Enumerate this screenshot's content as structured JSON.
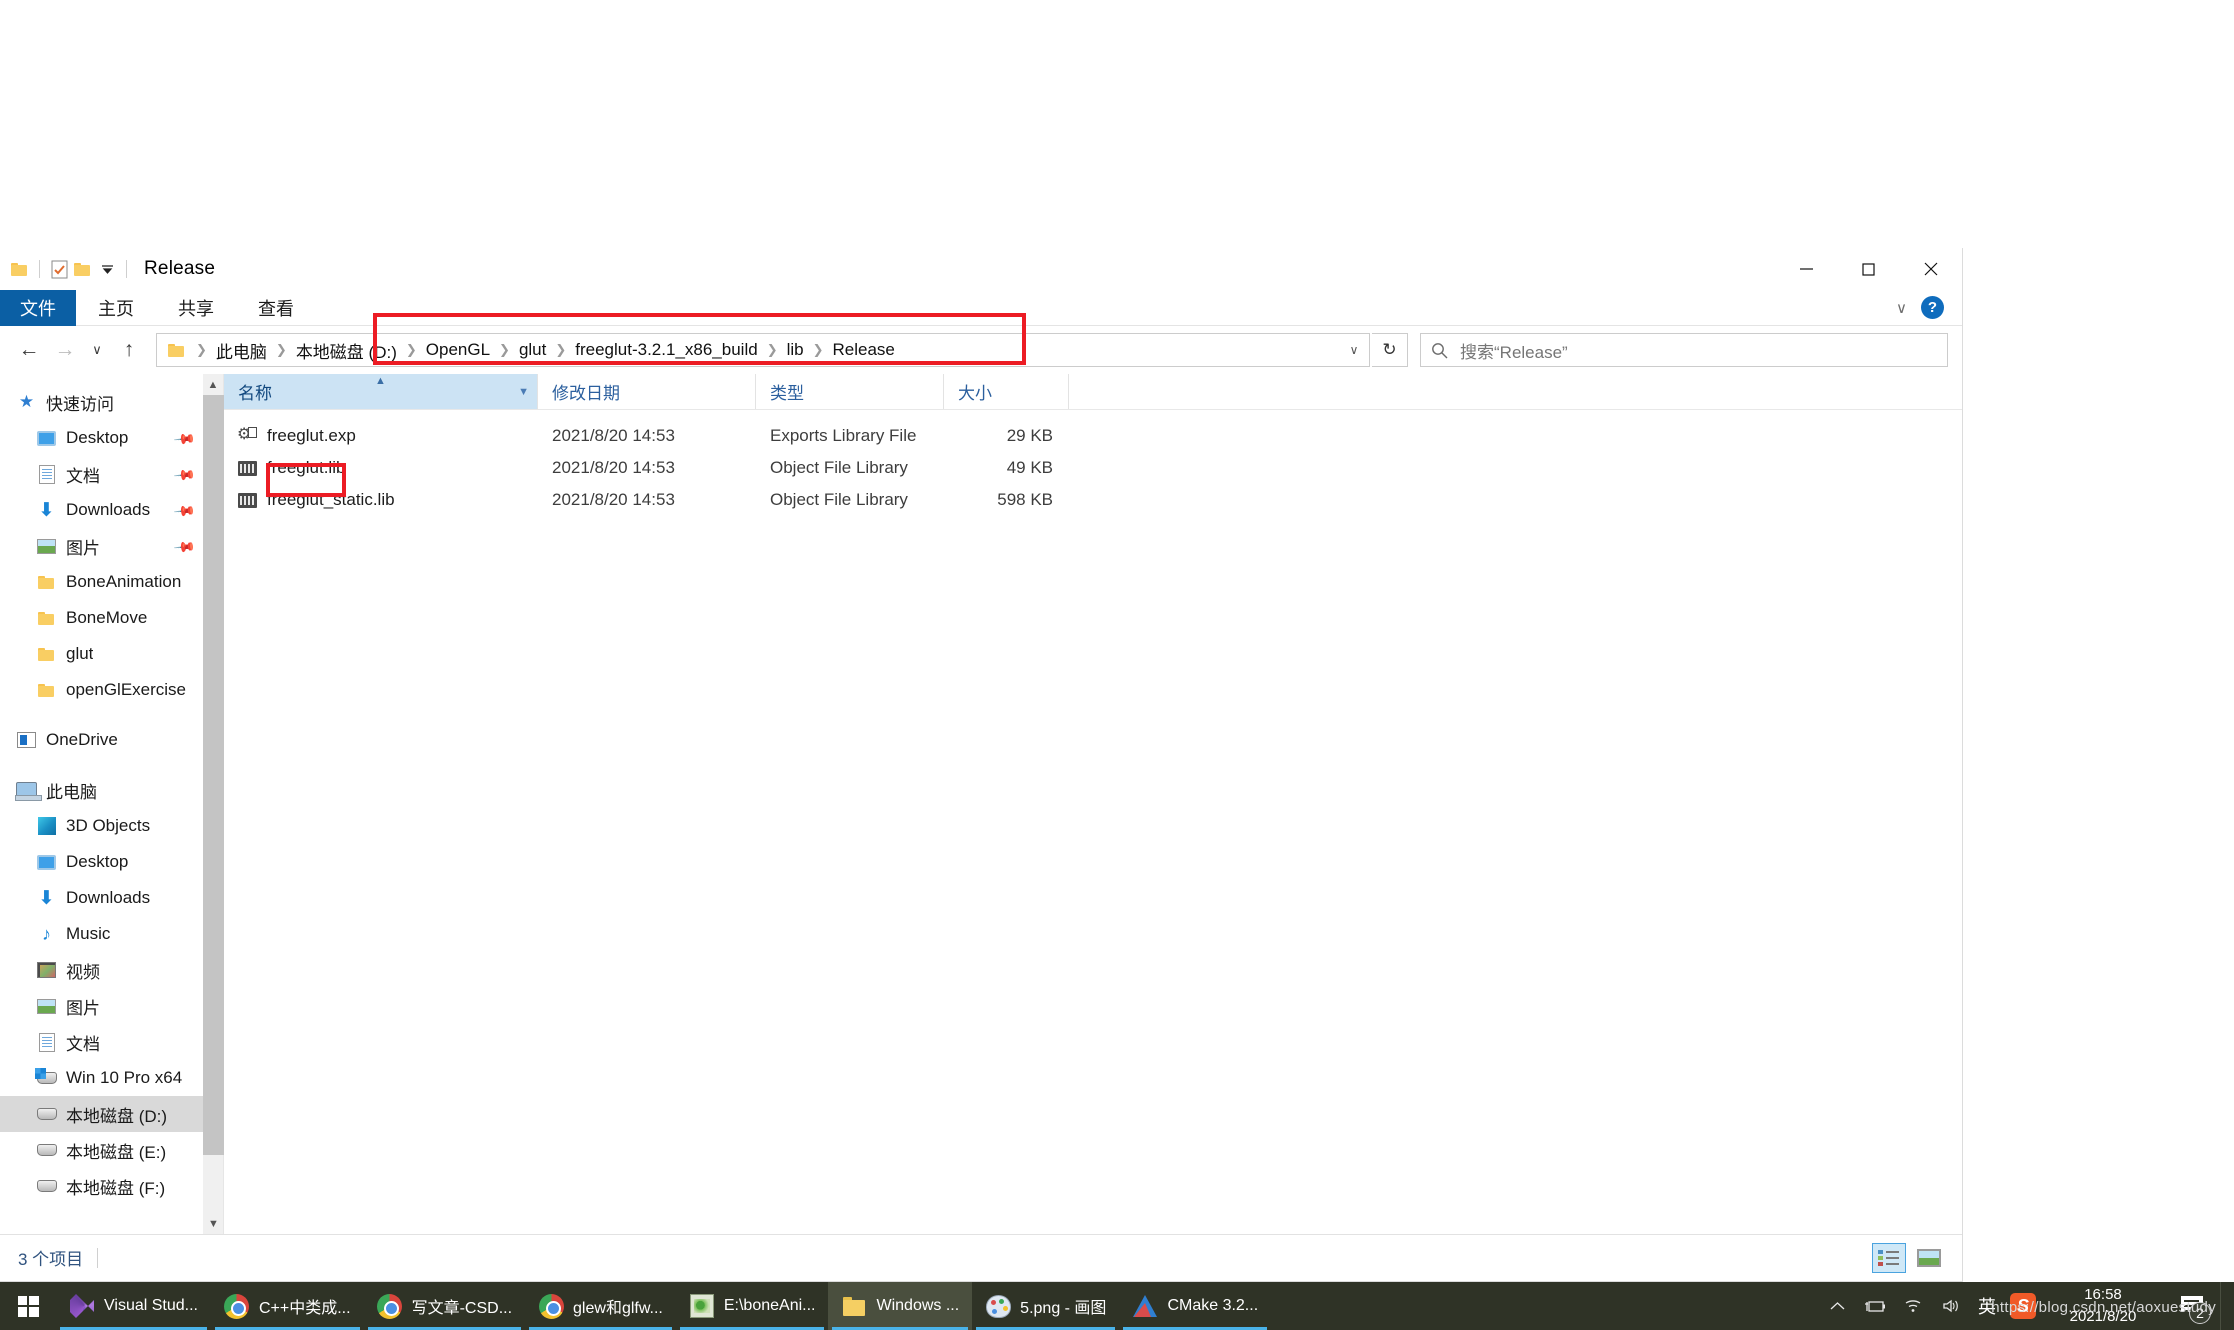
{
  "window": {
    "title": "Release",
    "quick_access": [
      "folder-icon",
      "checkbox-doc-icon",
      "folder-icon",
      "dropdown-caret-icon"
    ],
    "controls": {
      "minimize": "minimize-icon",
      "restore": "restore-icon",
      "close": "close-icon"
    }
  },
  "ribbon": {
    "tabs": [
      {
        "label": "文件",
        "active": true
      },
      {
        "label": "主页",
        "active": false
      },
      {
        "label": "共享",
        "active": false
      },
      {
        "label": "查看",
        "active": false
      }
    ],
    "collapse_label": "∨",
    "help_label": "?"
  },
  "nav": {
    "back": "←",
    "forward": "→",
    "recent": "∨",
    "up": "↑",
    "breadcrumb": [
      "此电脑",
      "本地磁盘 (D:)",
      "OpenGL",
      "glut",
      "freeglut-3.2.1_x86_build",
      "lib",
      "Release"
    ],
    "separator": "❯",
    "address_dropdown": "∨",
    "refresh": "↻"
  },
  "search": {
    "icon": "search-icon",
    "placeholder": "搜索“Release”"
  },
  "sidebar": {
    "sections": [
      {
        "header": {
          "label": "快速访问",
          "icon": "star-icon"
        },
        "items": [
          {
            "label": "Desktop",
            "icon": "desktop-icon",
            "pinned": true
          },
          {
            "label": "文档",
            "icon": "document-icon",
            "pinned": true
          },
          {
            "label": "Downloads",
            "icon": "download-icon",
            "pinned": true
          },
          {
            "label": "图片",
            "icon": "pictures-icon",
            "pinned": true
          },
          {
            "label": "BoneAnimation",
            "icon": "folder-icon",
            "pinned": false
          },
          {
            "label": "BoneMove",
            "icon": "folder-icon",
            "pinned": false
          },
          {
            "label": "glut",
            "icon": "folder-icon",
            "pinned": false
          },
          {
            "label": "openGlExercise",
            "icon": "folder-icon",
            "pinned": false
          }
        ]
      },
      {
        "header": {
          "label": "OneDrive",
          "icon": "onedrive-icon"
        },
        "items": []
      },
      {
        "header": {
          "label": "此电脑",
          "icon": "this-pc-icon"
        },
        "items": [
          {
            "label": "3D Objects",
            "icon": "3d-objects-icon",
            "selected": false
          },
          {
            "label": "Desktop",
            "icon": "desktop-icon",
            "selected": false
          },
          {
            "label": "Downloads",
            "icon": "download-icon",
            "selected": false
          },
          {
            "label": "Music",
            "icon": "music-icon",
            "selected": false
          },
          {
            "label": "视频",
            "icon": "videos-icon",
            "selected": false
          },
          {
            "label": "图片",
            "icon": "pictures-icon",
            "selected": false
          },
          {
            "label": "文档",
            "icon": "document-icon",
            "selected": false
          },
          {
            "label": "Win 10 Pro x64",
            "icon": "windows-drive-icon",
            "selected": false
          },
          {
            "label": "本地磁盘 (D:)",
            "icon": "drive-icon",
            "selected": true
          },
          {
            "label": "本地磁盘 (E:)",
            "icon": "drive-icon",
            "selected": false
          },
          {
            "label": "本地磁盘 (F:)",
            "icon": "drive-icon",
            "selected": false
          }
        ]
      }
    ]
  },
  "file_list": {
    "columns": [
      {
        "label": "名称",
        "sorted": true,
        "sort_dir": "asc"
      },
      {
        "label": "修改日期",
        "sorted": false
      },
      {
        "label": "类型",
        "sorted": false
      },
      {
        "label": "大小",
        "sorted": false
      }
    ],
    "rows": [
      {
        "name": "freeglut.exp",
        "icon": "exports-file-icon",
        "date": "2021/8/20 14:53",
        "type": "Exports Library File",
        "size": "29 KB",
        "highlighted": false
      },
      {
        "name": "freeglut.lib",
        "icon": "library-file-icon",
        "date": "2021/8/20 14:53",
        "type": "Object File Library",
        "size": "49 KB",
        "highlighted": true
      },
      {
        "name": "freeglut_static.lib",
        "icon": "library-file-icon",
        "date": "2021/8/20 14:53",
        "type": "Object File Library",
        "size": "598 KB",
        "highlighted": false
      }
    ]
  },
  "status": {
    "item_count": "3 个项目",
    "views": [
      {
        "name": "details-view",
        "active": true
      },
      {
        "name": "large-icons-view",
        "active": false
      }
    ]
  },
  "taskbar": {
    "start": "windows-logo-icon",
    "items": [
      {
        "label": "Visual Stud...",
        "icon": "visual-studio-icon",
        "active": false
      },
      {
        "label": "C++中类成...",
        "icon": "chrome-icon",
        "active": false
      },
      {
        "label": "写文章-CSD...",
        "icon": "chrome-icon",
        "active": false
      },
      {
        "label": "glew和glfw...",
        "icon": "chrome-icon",
        "active": false
      },
      {
        "label": "E:\\boneAni...",
        "icon": "notepadpp-icon",
        "active": false
      },
      {
        "label": "Windows ...",
        "icon": "folder-icon",
        "active": true
      },
      {
        "label": "5.png - 画图",
        "icon": "paint-icon",
        "active": false
      },
      {
        "label": "CMake 3.2...",
        "icon": "cmake-icon",
        "active": false
      }
    ],
    "tray": [
      {
        "name": "show-hidden-icons",
        "glyph": "∧"
      },
      {
        "name": "battery-icon",
        "glyph": "▭"
      },
      {
        "name": "wifi-icon",
        "glyph": "◠"
      },
      {
        "name": "volume-icon",
        "glyph": "◁"
      }
    ],
    "ime": "英",
    "sogou": "S",
    "clock": {
      "time": "16:58",
      "date": "2021/8/20"
    },
    "notifications": {
      "icon": "notification-icon",
      "count": "2"
    }
  },
  "watermark": "https://blog.csdn.net/aoxuestudy"
}
